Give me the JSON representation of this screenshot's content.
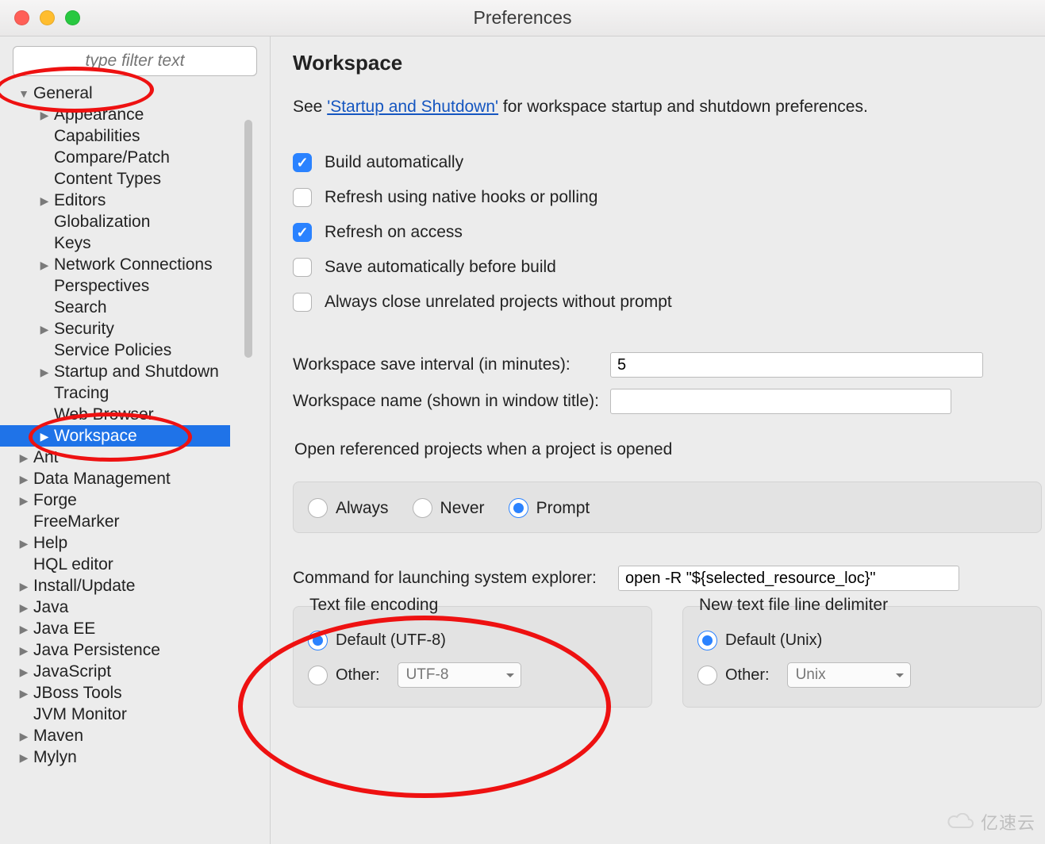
{
  "window": {
    "title": "Preferences"
  },
  "sidebar": {
    "filter_placeholder": "type filter text",
    "items": [
      {
        "label": "General",
        "depth": 0,
        "arrow": "down",
        "selected": false
      },
      {
        "label": "Appearance",
        "depth": 1,
        "arrow": "right",
        "selected": false
      },
      {
        "label": "Capabilities",
        "depth": 1,
        "arrow": "",
        "selected": false
      },
      {
        "label": "Compare/Patch",
        "depth": 1,
        "arrow": "",
        "selected": false
      },
      {
        "label": "Content Types",
        "depth": 1,
        "arrow": "",
        "selected": false
      },
      {
        "label": "Editors",
        "depth": 1,
        "arrow": "right",
        "selected": false
      },
      {
        "label": "Globalization",
        "depth": 1,
        "arrow": "",
        "selected": false
      },
      {
        "label": "Keys",
        "depth": 1,
        "arrow": "",
        "selected": false
      },
      {
        "label": "Network Connections",
        "depth": 1,
        "arrow": "right",
        "selected": false
      },
      {
        "label": "Perspectives",
        "depth": 1,
        "arrow": "",
        "selected": false
      },
      {
        "label": "Search",
        "depth": 1,
        "arrow": "",
        "selected": false
      },
      {
        "label": "Security",
        "depth": 1,
        "arrow": "right",
        "selected": false
      },
      {
        "label": "Service Policies",
        "depth": 1,
        "arrow": "",
        "selected": false
      },
      {
        "label": "Startup and Shutdown",
        "depth": 1,
        "arrow": "right",
        "selected": false
      },
      {
        "label": "Tracing",
        "depth": 1,
        "arrow": "",
        "selected": false
      },
      {
        "label": "Web Browser",
        "depth": 1,
        "arrow": "",
        "selected": false
      },
      {
        "label": "Workspace",
        "depth": 1,
        "arrow": "right",
        "selected": true
      },
      {
        "label": "Ant",
        "depth": 0,
        "arrow": "right",
        "selected": false
      },
      {
        "label": "Data Management",
        "depth": 0,
        "arrow": "right",
        "selected": false
      },
      {
        "label": "Forge",
        "depth": 0,
        "arrow": "right",
        "selected": false
      },
      {
        "label": "FreeMarker",
        "depth": 0,
        "arrow": "",
        "selected": false
      },
      {
        "label": "Help",
        "depth": 0,
        "arrow": "right",
        "selected": false
      },
      {
        "label": "HQL editor",
        "depth": 0,
        "arrow": "",
        "selected": false
      },
      {
        "label": "Install/Update",
        "depth": 0,
        "arrow": "right",
        "selected": false
      },
      {
        "label": "Java",
        "depth": 0,
        "arrow": "right",
        "selected": false
      },
      {
        "label": "Java EE",
        "depth": 0,
        "arrow": "right",
        "selected": false
      },
      {
        "label": "Java Persistence",
        "depth": 0,
        "arrow": "right",
        "selected": false
      },
      {
        "label": "JavaScript",
        "depth": 0,
        "arrow": "right",
        "selected": false
      },
      {
        "label": "JBoss Tools",
        "depth": 0,
        "arrow": "right",
        "selected": false
      },
      {
        "label": "JVM Monitor",
        "depth": 0,
        "arrow": "",
        "selected": false
      },
      {
        "label": "Maven",
        "depth": 0,
        "arrow": "right",
        "selected": false
      },
      {
        "label": "Mylyn",
        "depth": 0,
        "arrow": "right",
        "selected": false
      }
    ]
  },
  "main": {
    "heading": "Workspace",
    "intro_pre": "See ",
    "intro_link": "'Startup and Shutdown'",
    "intro_post": " for workspace startup and shutdown preferences.",
    "checks": [
      {
        "label": "Build automatically",
        "checked": true
      },
      {
        "label": "Refresh using native hooks or polling",
        "checked": false
      },
      {
        "label": "Refresh on access",
        "checked": true
      },
      {
        "label": "Save automatically before build",
        "checked": false
      },
      {
        "label": "Always close unrelated projects without prompt",
        "checked": false
      }
    ],
    "interval_label": "Workspace save interval (in minutes):",
    "interval_value": "5",
    "name_label": "Workspace name (shown in window title):",
    "name_value": "",
    "open_ref_title": "Open referenced projects when a project is opened",
    "open_ref_opts": [
      "Always",
      "Never",
      "Prompt"
    ],
    "open_ref_selected": "Prompt",
    "cmd_label": "Command for launching system explorer:",
    "cmd_value": "open -R \"${selected_resource_loc}\"",
    "encoding": {
      "title": "Text file encoding",
      "default_label": "Default (UTF-8)",
      "other_label": "Other:",
      "other_value": "UTF-8",
      "selected": "default"
    },
    "delimiter": {
      "title": "New text file line delimiter",
      "default_label": "Default (Unix)",
      "other_label": "Other:",
      "other_value": "Unix",
      "selected": "default"
    }
  },
  "watermark": "亿速云"
}
